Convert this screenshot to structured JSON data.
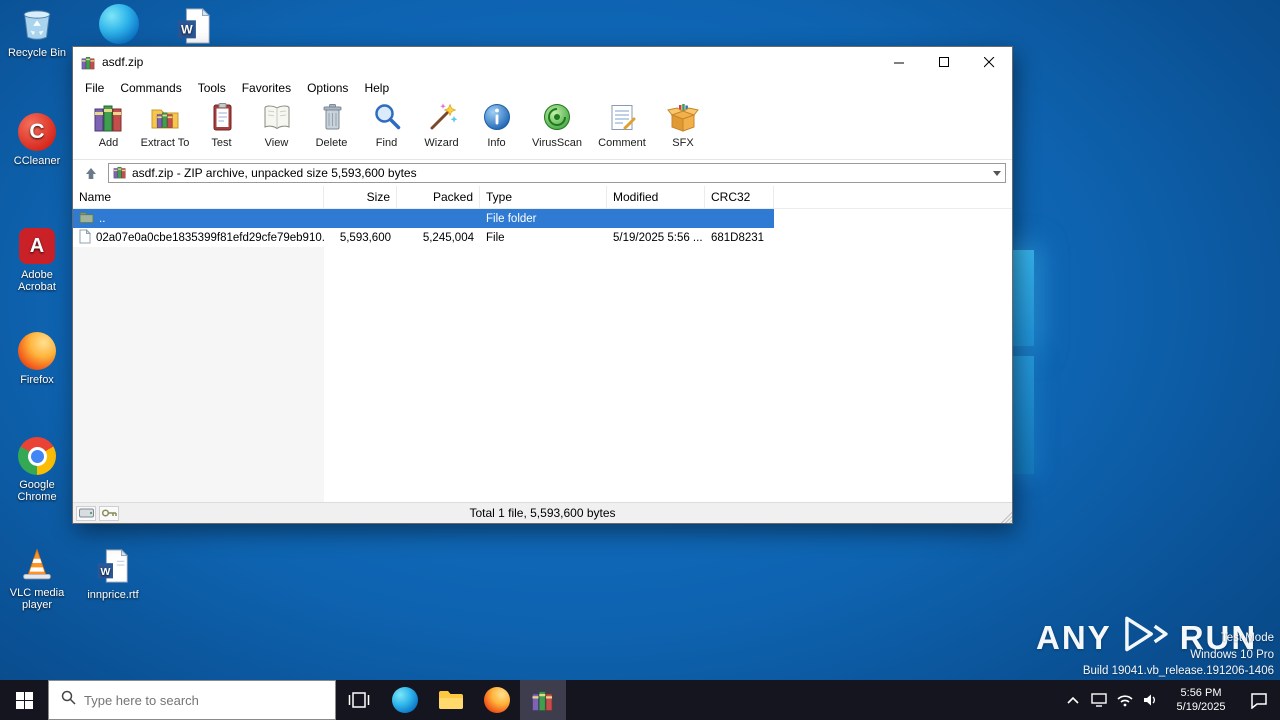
{
  "colors": {
    "selection": "#2f7bd3",
    "desktop_blue": "#0e63b0",
    "taskbar_bg": "#15151f",
    "accent_edge": "#0c74c8"
  },
  "desktop": {
    "icons": [
      {
        "label": "Recycle Bin"
      },
      {
        "label": "CCleaner"
      },
      {
        "label": "Adobe Acrobat"
      },
      {
        "label": "Firefox"
      },
      {
        "label": "Google Chrome"
      },
      {
        "label": "VLC media player"
      },
      {
        "label": "innprice.rtf"
      }
    ]
  },
  "window": {
    "title": "asdf.zip",
    "menu": [
      {
        "label": "File"
      },
      {
        "label": "Commands"
      },
      {
        "label": "Tools"
      },
      {
        "label": "Favorites"
      },
      {
        "label": "Options"
      },
      {
        "label": "Help"
      }
    ],
    "toolbar": [
      {
        "label": "Add"
      },
      {
        "label": "Extract To"
      },
      {
        "label": "Test"
      },
      {
        "label": "View"
      },
      {
        "label": "Delete"
      },
      {
        "label": "Find"
      },
      {
        "label": "Wizard"
      },
      {
        "label": "Info"
      },
      {
        "label": "VirusScan"
      },
      {
        "label": "Comment"
      },
      {
        "label": "SFX"
      }
    ],
    "address": "asdf.zip - ZIP archive, unpacked size 5,593,600 bytes",
    "columns": {
      "name": "Name",
      "size": "Size",
      "packed": "Packed",
      "type": "Type",
      "modified": "Modified",
      "crc32": "CRC32"
    },
    "rows": [
      {
        "name": "..",
        "size": "",
        "packed": "",
        "type": "File folder",
        "modified": "",
        "crc32": ""
      },
      {
        "name": "02a07e0a0cbe1835399f81efd29cfe79eb910...",
        "size": "5,593,600",
        "packed": "5,245,004",
        "type": "File",
        "modified": "5/19/2025 5:56 ...",
        "crc32": "681D8231"
      }
    ],
    "status": "Total 1 file, 5,593,600 bytes"
  },
  "taskbar": {
    "search_placeholder": "Type here to search",
    "clock": {
      "time": "5:56 PM",
      "date": "5/19/2025"
    }
  },
  "watermark": {
    "brand_left": "ANY",
    "brand_right": "RUN",
    "lines": [
      {
        "text": "Test Mode"
      },
      {
        "text": "Windows 10 Pro"
      },
      {
        "text": "Build 19041.vb_release.191206-1406"
      }
    ]
  }
}
